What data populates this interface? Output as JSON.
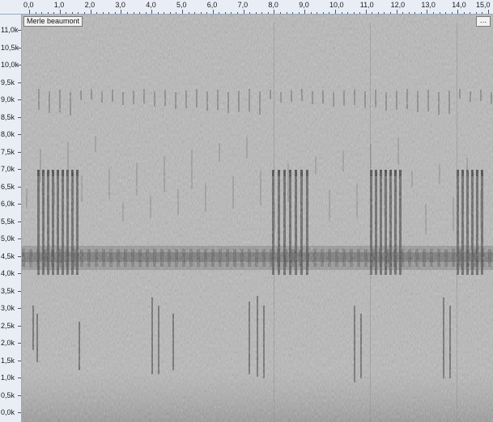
{
  "track": {
    "title": "Merle beaumont",
    "menu_label": "…"
  },
  "time_axis": {
    "labels": [
      "0,0",
      "1,0",
      "2,0",
      "3,0",
      "4,0",
      "5,0",
      "6,0",
      "7,0",
      "8,0",
      "9,0",
      "10,0",
      "11,0",
      "12,0",
      "13,0",
      "14,0",
      "15,0"
    ]
  },
  "freq_axis": {
    "labels": [
      "11,0k",
      "10,5k",
      "10,0k",
      "9,5k",
      "9,0k",
      "8,5k",
      "8,0k",
      "7,5k",
      "7,0k",
      "6,5k",
      "6,0k",
      "5,5k",
      "5,0k",
      "4,5k",
      "4,0k",
      "3,5k",
      "3,0k",
      "2,5k",
      "2,0k",
      "1,5k",
      "1,0k",
      "0,5k",
      "0,0k"
    ]
  },
  "colors": {
    "background": "#b9b9b9",
    "ruler": "#e9eef6"
  }
}
